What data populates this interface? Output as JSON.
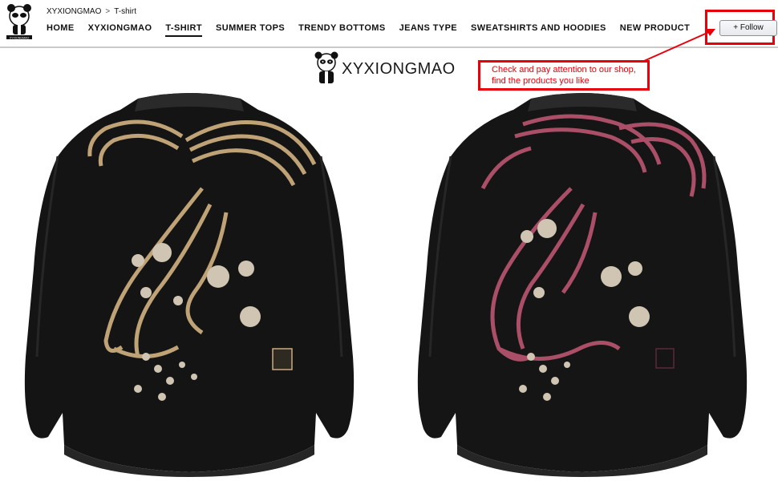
{
  "breadcrumb": {
    "store": "XYXIONGMAO",
    "separator": ">",
    "current": "T-shirt"
  },
  "logo": {
    "caption": "XYXIONGMAO"
  },
  "nav": [
    {
      "label": "HOME",
      "active": false
    },
    {
      "label": "XYXIONGMAO",
      "active": false
    },
    {
      "label": "T-SHIRT",
      "active": true
    },
    {
      "label": "SUMMER TOPS",
      "active": false
    },
    {
      "label": "TRENDY BOTTOMS",
      "active": false
    },
    {
      "label": "JEANS TYPE",
      "active": false
    },
    {
      "label": "SWEATSHIRTS AND HOODIES",
      "active": false
    },
    {
      "label": "NEW PRODUCT",
      "active": false
    }
  ],
  "follow": {
    "label": "+ Follow"
  },
  "annotation": {
    "line1": "Check and pay attention to our shop,",
    "line2": "find the products you like",
    "color": "#e8000b"
  },
  "brand_banner": {
    "text": "XYXIONGMAO"
  },
  "products": [
    {
      "embroidery_color": "#c9ab7c",
      "jacket_color": "#141414"
    },
    {
      "embroidery_color": "#b4526d",
      "jacket_color": "#151515"
    }
  ],
  "icons": [
    "panda-logo-icon",
    "panda-brand-icon",
    "arrow-icon"
  ]
}
